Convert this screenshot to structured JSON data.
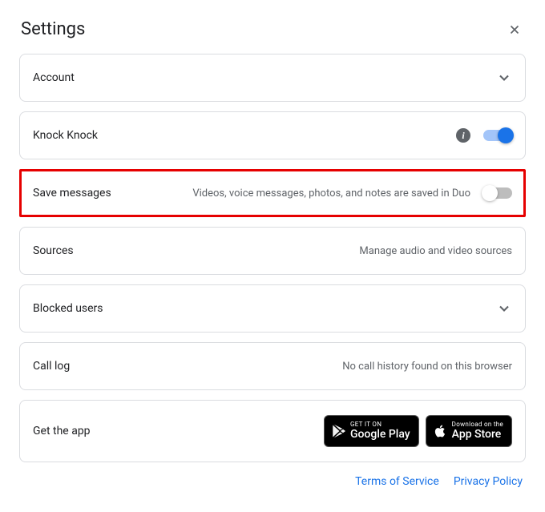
{
  "header": {
    "title": "Settings"
  },
  "rows": {
    "account": {
      "label": "Account"
    },
    "knock": {
      "label": "Knock Knock"
    },
    "save_messages": {
      "label": "Save messages",
      "desc": "Videos, voice messages, photos, and notes are saved in Duo"
    },
    "sources": {
      "label": "Sources",
      "desc": "Manage audio and video sources"
    },
    "blocked": {
      "label": "Blocked users"
    },
    "call_log": {
      "label": "Call log",
      "desc": "No call history found on this browser"
    },
    "get_app": {
      "label": "Get the app"
    }
  },
  "stores": {
    "google": {
      "small": "GET IT ON",
      "large": "Google Play"
    },
    "apple": {
      "small": "Download on the",
      "large": "App Store"
    }
  },
  "footer": {
    "terms": "Terms of Service",
    "privacy": "Privacy Policy"
  }
}
